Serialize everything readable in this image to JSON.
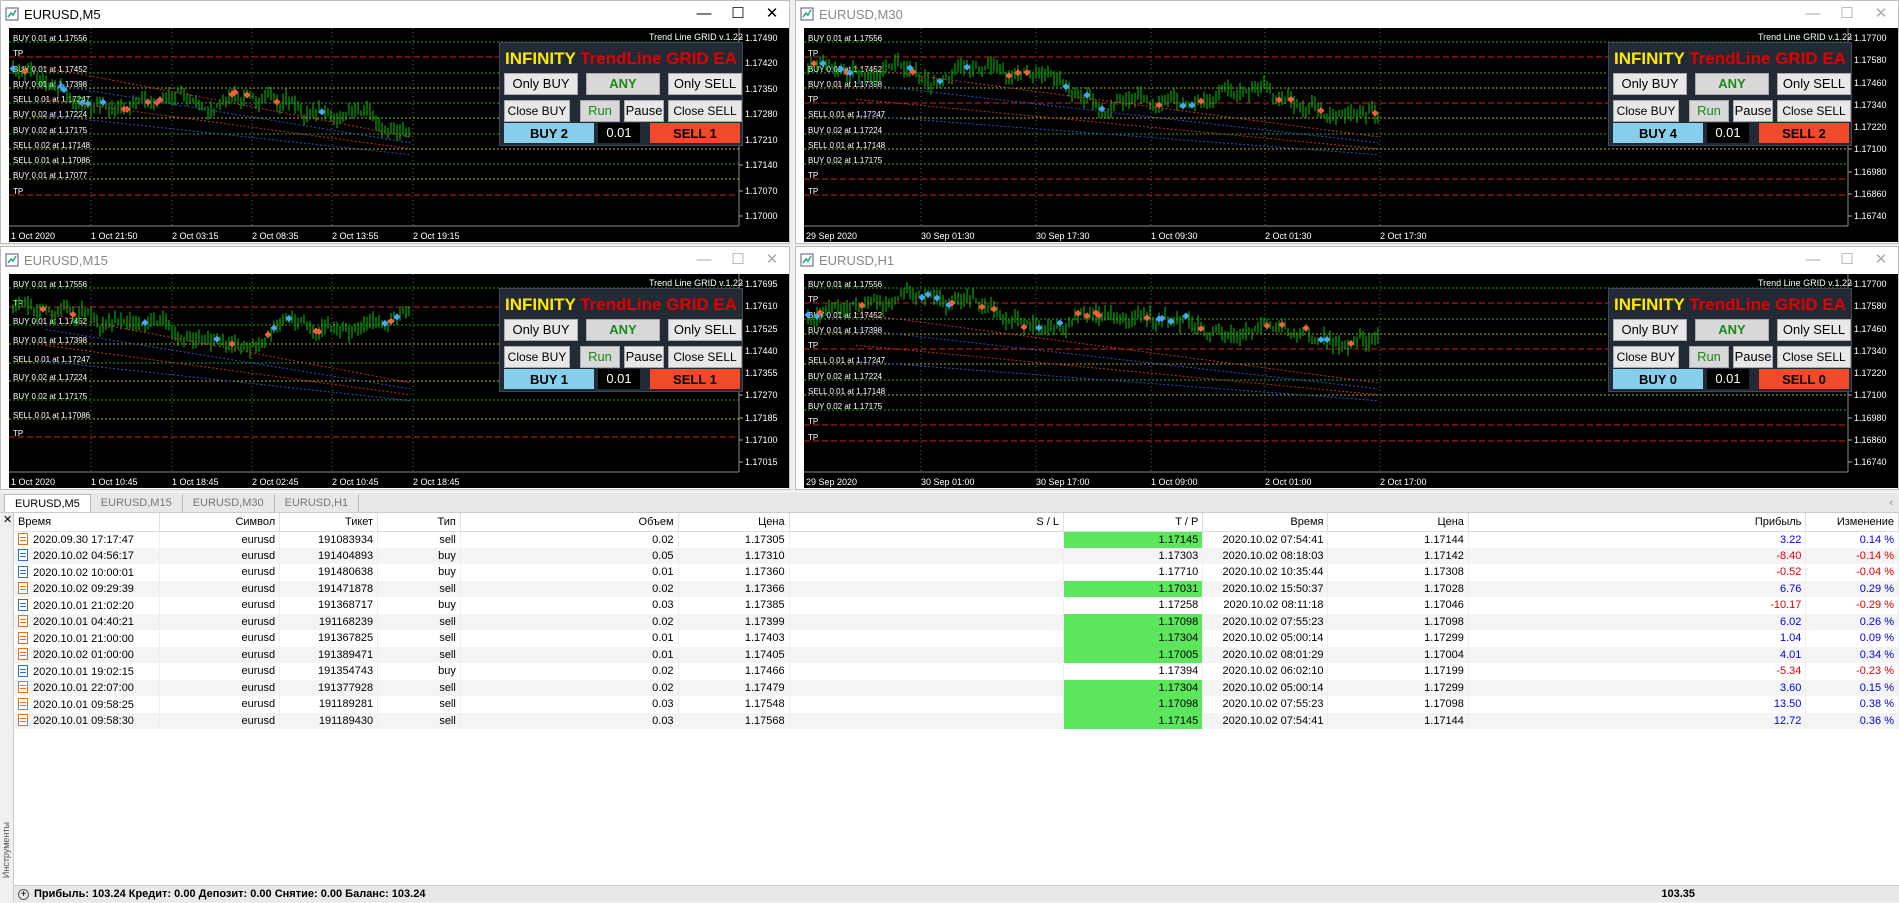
{
  "windows": [
    {
      "title": "EURUSD,M5",
      "active": true,
      "version": "Trend Line GRID v.1.22",
      "prices": [
        "1.17490",
        "1.17420",
        "1.17350",
        "1.17280",
        "1.17210",
        "1.17140",
        "1.17070",
        "1.17000"
      ],
      "times": [
        "1 Oct 2020",
        "1 Oct 21:50",
        "2 Oct 03:15",
        "2 Oct 08:35",
        "2 Oct 13:55",
        "2 Oct 19:15"
      ],
      "labels": [
        "BUY 0.01 at 1.17556",
        "TP",
        "BUY 0.01 at 1.17452",
        "BUY 0.01 at 1.17398",
        "SELL 0.01 at 1.17247",
        "BUY 0.02 at 1.17224",
        "BUY 0.02 at 1.17175",
        "SELL 0.02 at 1.17148",
        "SELL 0.01 at 1.17086",
        "BUY 0.01 at 1.17077",
        "TP"
      ],
      "panel": {
        "brand": "INFINITY",
        "name": "TrendLine GRID EA",
        "only_buy": "Only BUY",
        "any": "ANY",
        "only_sell": "Only SELL",
        "close_buy": "Close BUY",
        "run": "Run",
        "pause": "Pause",
        "close_sell": "Close SELL",
        "buy": "BUY 2",
        "lot": "0.01",
        "sell": "SELL 1"
      }
    },
    {
      "title": "EURUSD,M30",
      "active": false,
      "version": "Trend Line GRID v.1.22",
      "prices": [
        "1.17700",
        "1.17580",
        "1.17460",
        "1.17340",
        "1.17220",
        "1.17100",
        "1.16980",
        "1.16860",
        "1.16740"
      ],
      "times": [
        "29 Sep 2020",
        "30 Sep 01:30",
        "30 Sep 17:30",
        "1 Oct 09:30",
        "2 Oct 01:30",
        "2 Oct 17:30"
      ],
      "labels": [
        "BUY 0.01 at 1.17556",
        "TP",
        "BUY 0.01 at 1.17452",
        "BUY 0.01 at 1.17398",
        "TP",
        "SELL 0.01 at 1.17247",
        "BUY 0.02 at 1.17224",
        "SELL 0.01 at 1.17148",
        "BUY 0.02 at 1.17175",
        "TP",
        "TP"
      ],
      "panel": {
        "brand": "INFINITY",
        "name": "TrendLine GRID EA",
        "only_buy": "Only BUY",
        "any": "ANY",
        "only_sell": "Only SELL",
        "close_buy": "Close BUY",
        "run": "Run",
        "pause": "Pause",
        "close_sell": "Close SELL",
        "buy": "BUY 4",
        "lot": "0.01",
        "sell": "SELL 2"
      }
    },
    {
      "title": "EURUSD,M15",
      "active": false,
      "version": "Trend Line GRID v.1.22",
      "prices": [
        "1.17695",
        "1.17610",
        "1.17525",
        "1.17440",
        "1.17355",
        "1.17270",
        "1.17185",
        "1.17100",
        "1.17015"
      ],
      "times": [
        "1 Oct 2020",
        "1 Oct 10:45",
        "1 Oct 18:45",
        "2 Oct 02:45",
        "2 Oct 10:45",
        "2 Oct 18:45"
      ],
      "labels": [
        "BUY 0.01 at 1.17556",
        "TP",
        "BUY 0.01 at 1.17452",
        "BUY 0.01 at 1.17398",
        "SELL 0.01 at 1.17247",
        "BUY 0.02 at 1.17224",
        "BUY 0.02 at 1.17175",
        "SELL 0.01 at 1.17086",
        "TP"
      ],
      "panel": {
        "brand": "INFINITY",
        "name": "TrendLine GRID EA",
        "only_buy": "Only BUY",
        "any": "ANY",
        "only_sell": "Only SELL",
        "close_buy": "Close BUY",
        "run": "Run",
        "pause": "Pause",
        "close_sell": "Close SELL",
        "buy": "BUY 1",
        "lot": "0.01",
        "sell": "SELL 1"
      }
    },
    {
      "title": "EURUSD,H1",
      "active": false,
      "version": "Trend Line GRID v.1.22",
      "prices": [
        "1.17700",
        "1.17580",
        "1.17460",
        "1.17340",
        "1.17220",
        "1.17100",
        "1.16980",
        "1.16860",
        "1.16740"
      ],
      "times": [
        "29 Sep 2020",
        "30 Sep 01:00",
        "30 Sep 17:00",
        "1 Oct 09:00",
        "2 Oct 01:00",
        "2 Oct 17:00"
      ],
      "labels": [
        "BUY 0.01 at 1.17556",
        "TP",
        "BUY 0.01 at 1.17452",
        "BUY 0.01 at 1.17398",
        "TP",
        "SELL 0.01 at 1.17247",
        "BUY 0.02 at 1.17224",
        "SELL 0.01 at 1.17148",
        "BUY 0.02 at 1.17175",
        "TP",
        "TP"
      ],
      "panel": {
        "brand": "INFINITY",
        "name": "TrendLine GRID EA",
        "only_buy": "Only BUY",
        "any": "ANY",
        "only_sell": "Only SELL",
        "close_buy": "Close BUY",
        "run": "Run",
        "pause": "Pause",
        "close_sell": "Close SELL",
        "buy": "BUY 0",
        "lot": "0.01",
        "sell": "SELL 0"
      }
    }
  ],
  "tabs": [
    "EURUSD,M5",
    "EURUSD,M15",
    "EURUSD,M30",
    "EURUSD,H1"
  ],
  "terminal": {
    "side_label": "Инструменты",
    "headers": [
      "Время",
      "Символ",
      "Тикет",
      "Тип",
      "Объем",
      "Цена",
      "S / L",
      "T / P",
      "Время",
      "Цена",
      "Прибыль",
      "Изменение"
    ],
    "rows": [
      {
        "time": "2020.09.30 17:17:47",
        "symbol": "eurusd",
        "ticket": "191083934",
        "type": "sell",
        "volume": "0.02",
        "price": "1.17305",
        "sl": "",
        "tp": "1.17145",
        "tp_hit": true,
        "ctime": "2020.10.02 07:54:41",
        "cprice": "1.17144",
        "profit": "3.22",
        "change": "0.14 %"
      },
      {
        "time": "2020.10.02 04:56:17",
        "symbol": "eurusd",
        "ticket": "191404893",
        "type": "buy",
        "volume": "0.05",
        "price": "1.17310",
        "sl": "",
        "tp": "1.17303",
        "tp_hit": false,
        "ctime": "2020.10.02 08:18:03",
        "cprice": "1.17142",
        "profit": "-8.40",
        "change": "-0.14 %"
      },
      {
        "time": "2020.10.02 10:00:01",
        "symbol": "eurusd",
        "ticket": "191480638",
        "type": "buy",
        "volume": "0.01",
        "price": "1.17360",
        "sl": "",
        "tp": "1.17710",
        "tp_hit": false,
        "ctime": "2020.10.02 10:35:44",
        "cprice": "1.17308",
        "profit": "-0.52",
        "change": "-0.04 %"
      },
      {
        "time": "2020.10.02 09:29:39",
        "symbol": "eurusd",
        "ticket": "191471878",
        "type": "sell",
        "volume": "0.02",
        "price": "1.17366",
        "sl": "",
        "tp": "1.17031",
        "tp_hit": true,
        "ctime": "2020.10.02 15:50:37",
        "cprice": "1.17028",
        "profit": "6.76",
        "change": "0.29 %"
      },
      {
        "time": "2020.10.01 21:02:20",
        "symbol": "eurusd",
        "ticket": "191368717",
        "type": "buy",
        "volume": "0.03",
        "price": "1.17385",
        "sl": "",
        "tp": "1.17258",
        "tp_hit": false,
        "ctime": "2020.10.02 08:11:18",
        "cprice": "1.17046",
        "profit": "-10.17",
        "change": "-0.29 %"
      },
      {
        "time": "2020.10.01 04:40:21",
        "symbol": "eurusd",
        "ticket": "191168239",
        "type": "sell",
        "volume": "0.02",
        "price": "1.17399",
        "sl": "",
        "tp": "1.17098",
        "tp_hit": true,
        "ctime": "2020.10.02 07:55:23",
        "cprice": "1.17098",
        "profit": "6.02",
        "change": "0.26 %"
      },
      {
        "time": "2020.10.01 21:00:00",
        "symbol": "eurusd",
        "ticket": "191367825",
        "type": "sell",
        "volume": "0.01",
        "price": "1.17403",
        "sl": "",
        "tp": "1.17304",
        "tp_hit": true,
        "ctime": "2020.10.02 05:00:14",
        "cprice": "1.17299",
        "profit": "1.04",
        "change": "0.09 %"
      },
      {
        "time": "2020.10.02 01:00:00",
        "symbol": "eurusd",
        "ticket": "191389471",
        "type": "sell",
        "volume": "0.01",
        "price": "1.17405",
        "sl": "",
        "tp": "1.17005",
        "tp_hit": true,
        "ctime": "2020.10.02 08:01:29",
        "cprice": "1.17004",
        "profit": "4.01",
        "change": "0.34 %"
      },
      {
        "time": "2020.10.01 19:02:15",
        "symbol": "eurusd",
        "ticket": "191354743",
        "type": "buy",
        "volume": "0.02",
        "price": "1.17466",
        "sl": "",
        "tp": "1.17394",
        "tp_hit": false,
        "ctime": "2020.10.02 06:02:10",
        "cprice": "1.17199",
        "profit": "-5.34",
        "change": "-0.23 %"
      },
      {
        "time": "2020.10.01 22:07:00",
        "symbol": "eurusd",
        "ticket": "191377928",
        "type": "sell",
        "volume": "0.02",
        "price": "1.17479",
        "sl": "",
        "tp": "1.17304",
        "tp_hit": true,
        "ctime": "2020.10.02 05:00:14",
        "cprice": "1.17299",
        "profit": "3.60",
        "change": "0.15 %"
      },
      {
        "time": "2020.10.01 09:58:25",
        "symbol": "eurusd",
        "ticket": "191189281",
        "type": "sell",
        "volume": "0.03",
        "price": "1.17548",
        "sl": "",
        "tp": "1.17098",
        "tp_hit": true,
        "ctime": "2020.10.02 07:55:23",
        "cprice": "1.17098",
        "profit": "13.50",
        "change": "0.38 %"
      },
      {
        "time": "2020.10.01 09:58:30",
        "symbol": "eurusd",
        "ticket": "191189430",
        "type": "sell",
        "volume": "0.03",
        "price": "1.17568",
        "sl": "",
        "tp": "1.17145",
        "tp_hit": true,
        "ctime": "2020.10.02 07:54:41",
        "cprice": "1.17144",
        "profit": "12.72",
        "change": "0.36 %"
      }
    ],
    "status": "Прибыль: 103.24  Кредит: 0.00  Депозит: 0.00  Снятие: 0.00  Баланс: 103.24",
    "total": "103.35"
  },
  "colors": {
    "buy": "#87ceeb",
    "sell": "#f04a2a",
    "candle": "#00cc00",
    "tp_cell": "#5ce65c",
    "neg": "#e00000",
    "pos": "#0000e0"
  }
}
